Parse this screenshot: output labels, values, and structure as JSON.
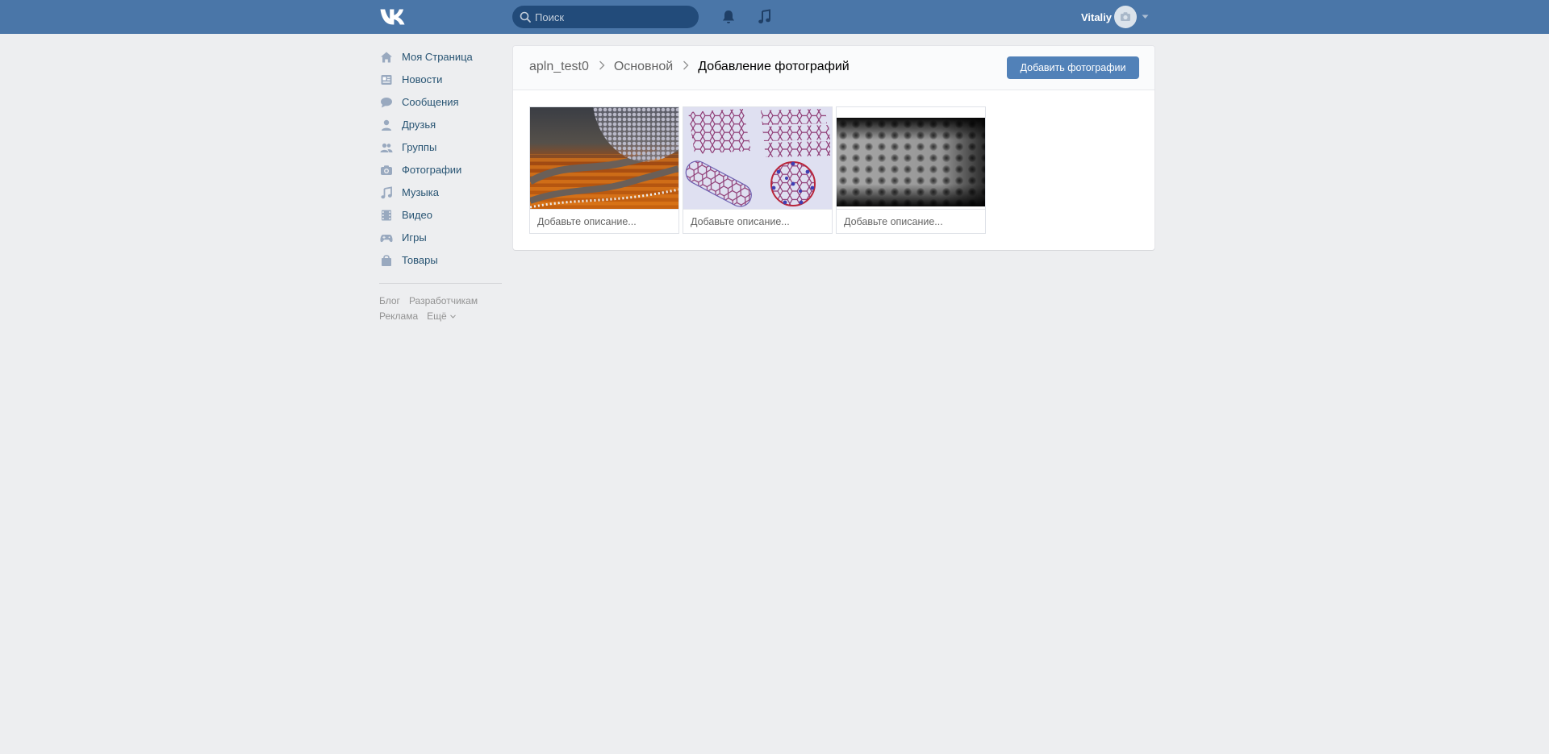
{
  "header": {
    "search_placeholder": "Поиск",
    "user_name": "Vitaliy"
  },
  "sidebar": {
    "items": [
      {
        "label": "Моя Страница",
        "icon": "home-icon"
      },
      {
        "label": "Новости",
        "icon": "news-icon"
      },
      {
        "label": "Сообщения",
        "icon": "messages-icon"
      },
      {
        "label": "Друзья",
        "icon": "friends-icon"
      },
      {
        "label": "Группы",
        "icon": "groups-icon"
      },
      {
        "label": "Фотографии",
        "icon": "camera-icon"
      },
      {
        "label": "Музыка",
        "icon": "music-note-icon"
      },
      {
        "label": "Видео",
        "icon": "video-icon"
      },
      {
        "label": "Игры",
        "icon": "gamepad-icon"
      },
      {
        "label": "Товары",
        "icon": "shopping-bag-icon"
      }
    ],
    "footer": {
      "blog": "Блог",
      "developers": "Разработчикам",
      "ads": "Реклама",
      "more": "Ещё"
    }
  },
  "main": {
    "breadcrumbs": [
      "apln_test0",
      "Основной",
      "Добавление фотографий"
    ],
    "add_button": "Добавить фотографии",
    "photos": [
      {
        "description_placeholder": "Добавьте описание..."
      },
      {
        "description_placeholder": "Добавьте описание..."
      },
      {
        "description_placeholder": "Добавьте описание..."
      }
    ]
  },
  "colors": {
    "header_bg": "#4a76a8",
    "page_bg": "#edeef0",
    "link": "#285473",
    "button": "#5181b8"
  }
}
